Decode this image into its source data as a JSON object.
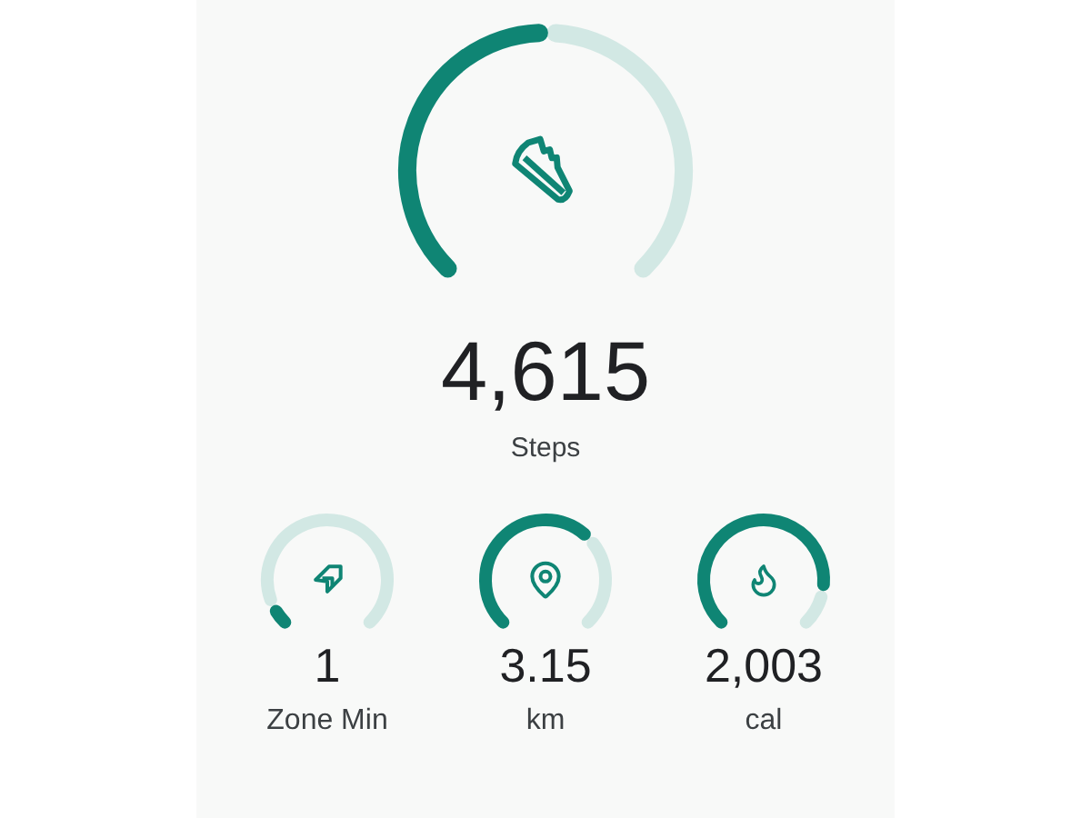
{
  "main": {
    "kind": "steps",
    "value": "4,615",
    "label": "Steps"
  },
  "metrics": [
    {
      "kind": "zone",
      "value": "1",
      "label": "Zone Min"
    },
    {
      "kind": "distance",
      "value": "3.15",
      "label": "km"
    },
    {
      "kind": "energy",
      "value": "2,003",
      "label": "cal"
    }
  ]
}
